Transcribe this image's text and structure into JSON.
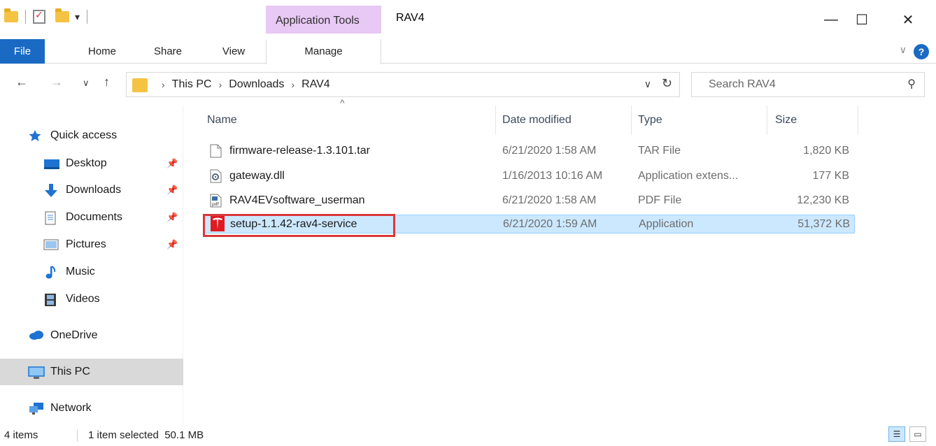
{
  "window": {
    "title": "RAV4",
    "context_tab": "Application Tools",
    "minimize": "—",
    "maximize": "☐",
    "close": "✕"
  },
  "ribbon": {
    "tabs": [
      {
        "label": "File"
      },
      {
        "label": "Home"
      },
      {
        "label": "Share"
      },
      {
        "label": "View"
      },
      {
        "label": "Manage"
      }
    ],
    "help": "?",
    "collapse": "∨"
  },
  "nav": {
    "back": "←",
    "forward": "→",
    "recent": "∨",
    "up": "↑",
    "breadcrumb": [
      "This PC",
      "Downloads",
      "RAV4"
    ],
    "chevron": "›",
    "dropdown": "∨",
    "refresh": "↻"
  },
  "search": {
    "placeholder": "Search RAV4",
    "icon": "⚲"
  },
  "sidebar": {
    "items": [
      {
        "label": "Quick access",
        "icon": "star-icon"
      },
      {
        "label": "Desktop",
        "icon": "desktop-icon",
        "pinned": true
      },
      {
        "label": "Downloads",
        "icon": "download-arrow-icon",
        "pinned": true
      },
      {
        "label": "Documents",
        "icon": "document-icon",
        "pinned": true
      },
      {
        "label": "Pictures",
        "icon": "picture-icon",
        "pinned": true
      },
      {
        "label": "Music",
        "icon": "music-note-icon"
      },
      {
        "label": "Videos",
        "icon": "film-icon"
      },
      {
        "label": "OneDrive",
        "icon": "cloud-icon"
      },
      {
        "label": "This PC",
        "icon": "monitor-icon",
        "selected": true
      },
      {
        "label": "Network",
        "icon": "network-icon"
      }
    ],
    "pin_glyph": "📌"
  },
  "filelist": {
    "columns": [
      "Name",
      "Date modified",
      "Type",
      "Size"
    ],
    "sort_indicator": "^",
    "rows": [
      {
        "name": "firmware-release-1.3.101.tar",
        "date": "6/21/2020 1:58 AM",
        "type": "TAR File",
        "size": "1,820 KB",
        "icon": "blank-file-icon"
      },
      {
        "name": "gateway.dll",
        "date": "1/16/2013 10:16 AM",
        "type": "Application extens...",
        "size": "177 KB",
        "icon": "dll-gear-file-icon"
      },
      {
        "name": "RAV4EVsoftware_userman",
        "date": "6/21/2020 1:58 AM",
        "type": "PDF File",
        "size": "12,230 KB",
        "icon": "pdf-file-icon"
      },
      {
        "name": "setup-1.1.42-rav4-service",
        "date": "6/21/2020 1:59 AM",
        "type": "Application",
        "size": "51,372 KB",
        "icon": "tesla-logo-icon",
        "selected": true
      }
    ]
  },
  "status": {
    "count": "4 items",
    "selection": "1 item selected  50.1 MB"
  },
  "colors": {
    "accent": "#1a6ac4",
    "context_tab": "#e8c8f4",
    "selection": "#cce8ff",
    "highlight_box": "#d9383a"
  }
}
